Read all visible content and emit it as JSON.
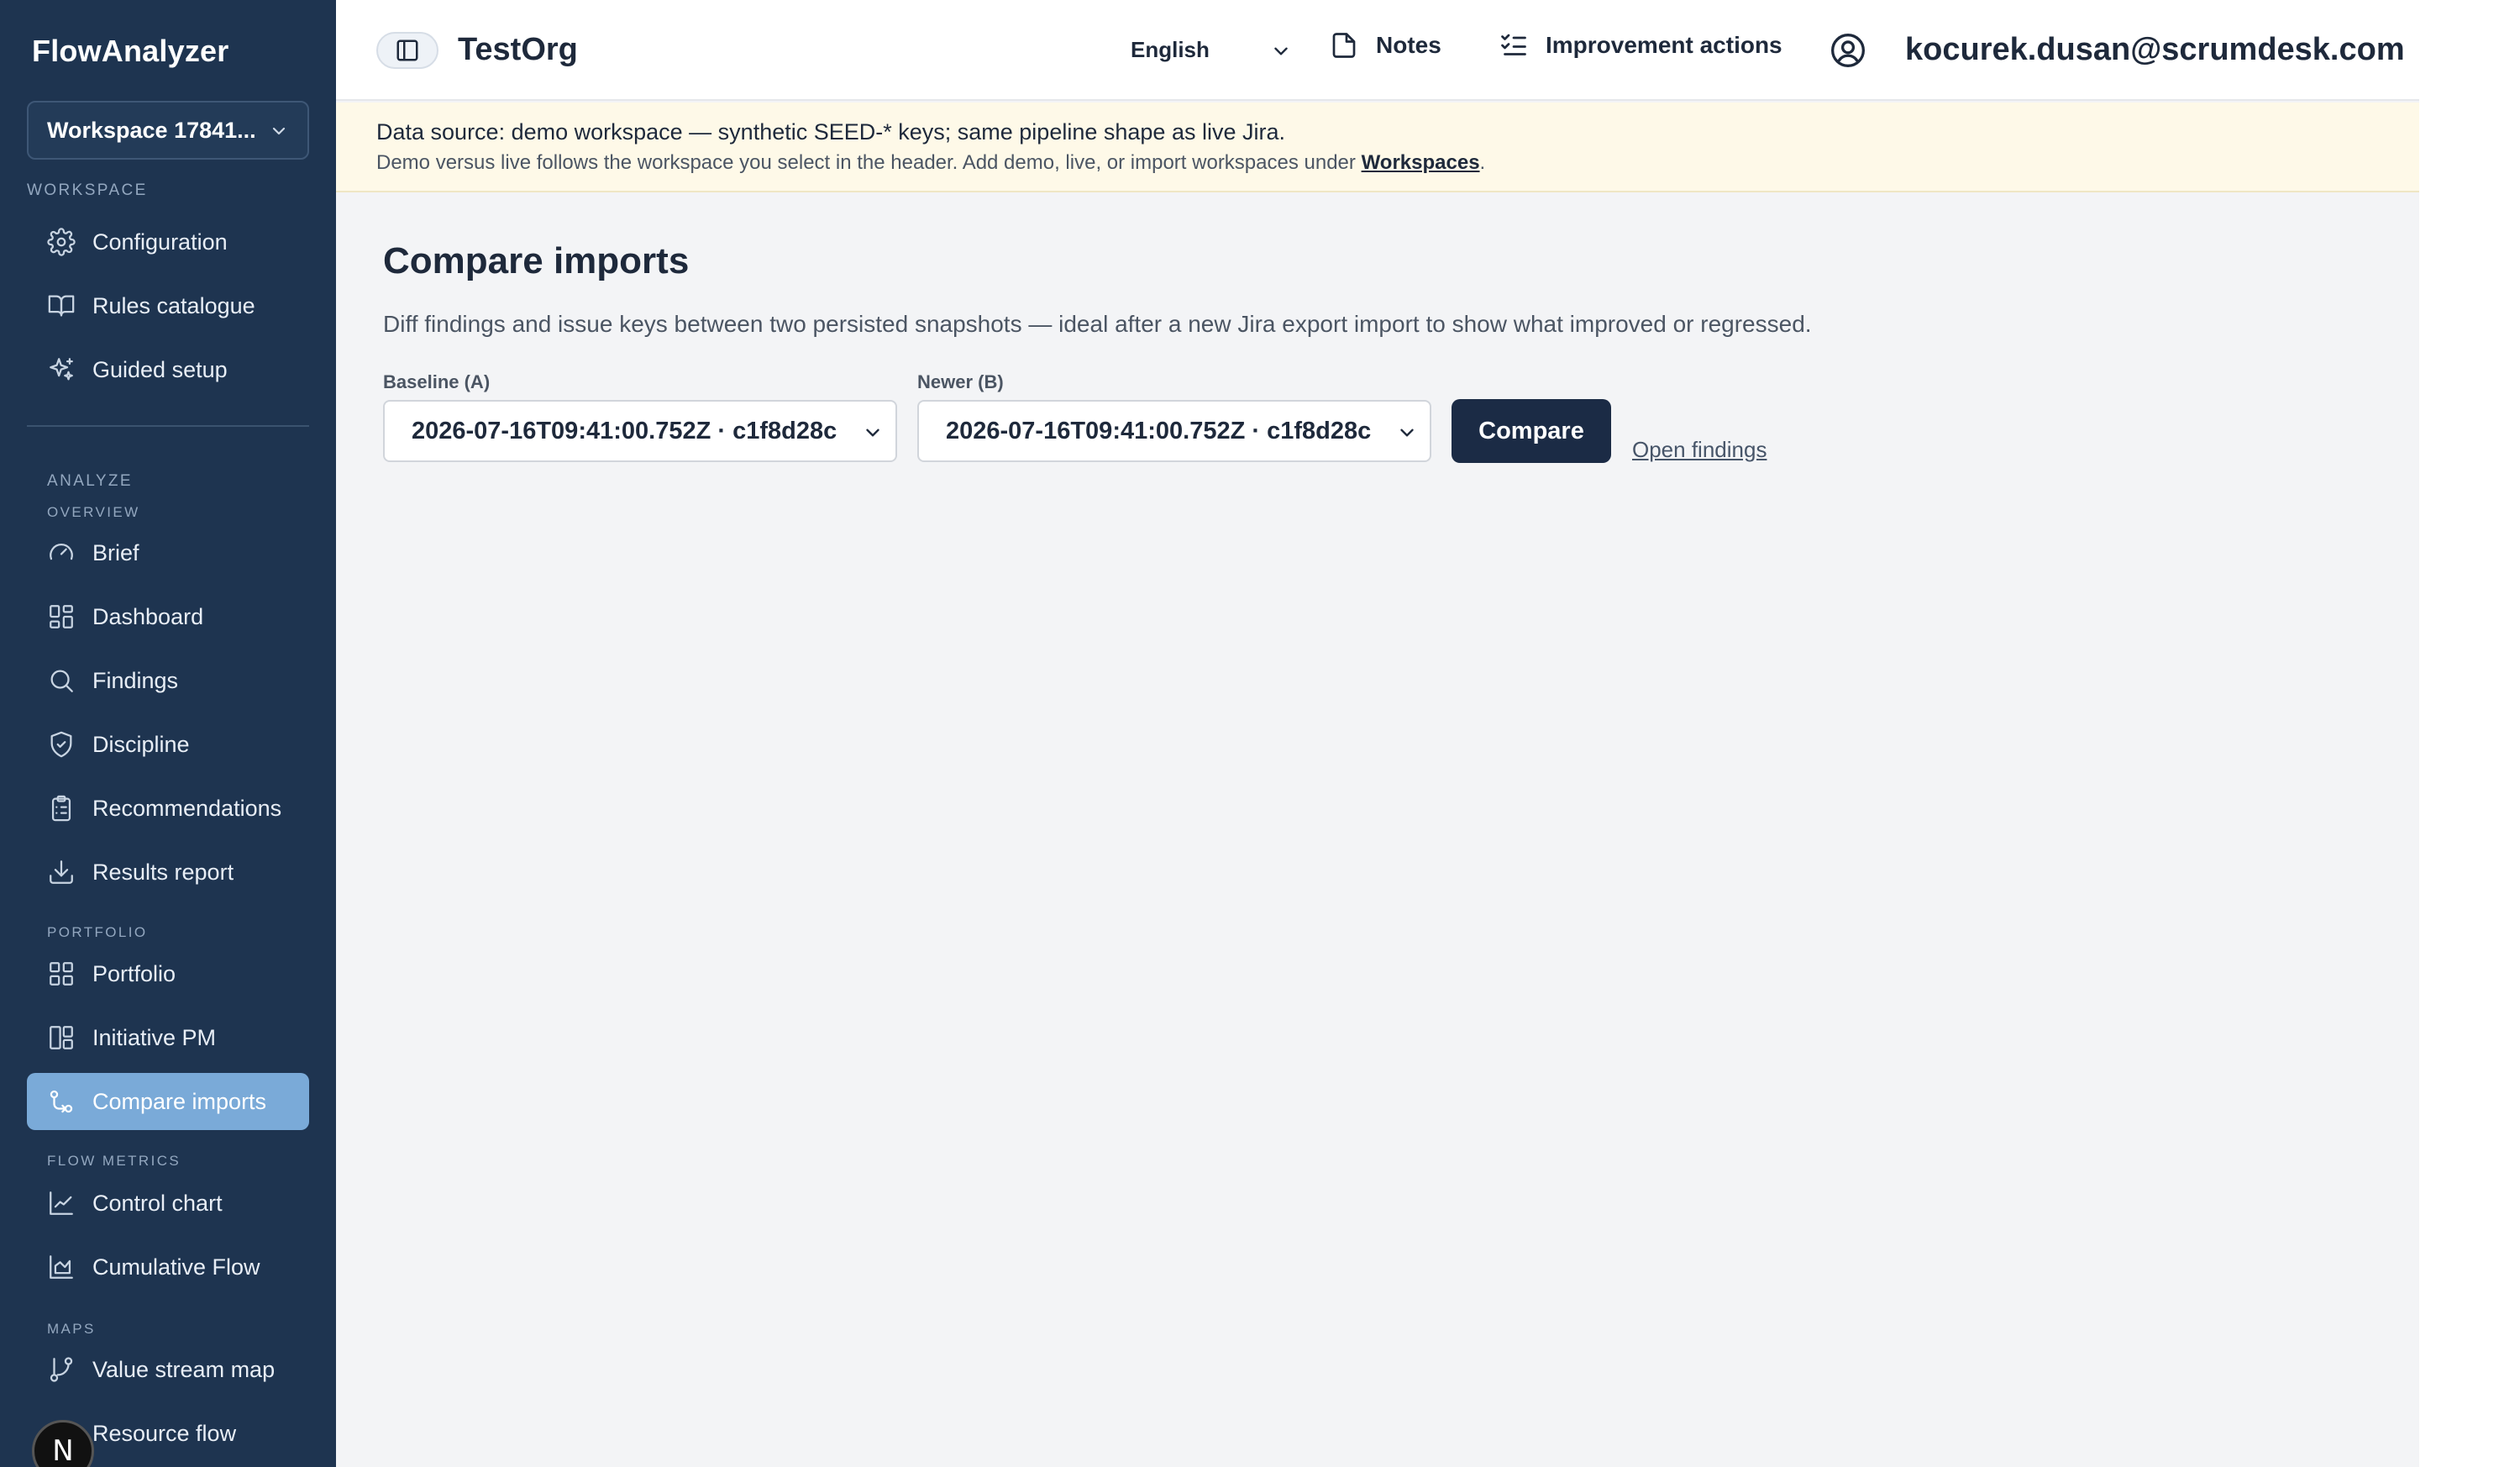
{
  "app": {
    "brand": "FlowAnalyzer"
  },
  "workspace": {
    "selected": "Workspace 17841..."
  },
  "sidebar": {
    "sections": {
      "workspace": "WORKSPACE",
      "analyze": "ANALYZE",
      "overview": "OVERVIEW",
      "portfolio": "PORTFOLIO",
      "flow_metrics": "FLOW METRICS",
      "maps": "MAPS"
    },
    "items": {
      "configuration": "Configuration",
      "rules_catalogue": "Rules catalogue",
      "guided_setup": "Guided setup",
      "brief": "Brief",
      "dashboard": "Dashboard",
      "findings": "Findings",
      "discipline": "Discipline",
      "recommendations": "Recommendations",
      "results_report": "Results report",
      "portfolio": "Portfolio",
      "initiative_pm": "Initiative PM",
      "compare_imports": "Compare imports",
      "control_chart": "Control chart",
      "cumulative_flow": "Cumulative Flow",
      "value_stream_map": "Value stream map",
      "resource_flow": "Resource flow"
    },
    "active": "compare_imports",
    "badge": "N"
  },
  "header": {
    "org": "TestOrg",
    "language": "English",
    "notes": "Notes",
    "improvement_actions": "Improvement actions",
    "user_email": "kocurek.dusan@scrumdesk.com"
  },
  "banner": {
    "line1": "Data source: demo workspace — synthetic SEED-* keys; same pipeline shape as live Jira.",
    "line2_prefix": "Demo versus live follows the workspace you select in the header. Add demo, live, or import workspaces under ",
    "line2_link": "Workspaces",
    "line2_suffix": "."
  },
  "main": {
    "title": "Compare imports",
    "description": "Diff findings and issue keys between two persisted snapshots — ideal after a new Jira export import to show what improved or regressed.",
    "baseline_label": "Baseline (A)",
    "baseline_value": "2026-07-16T09:41:00.752Z · c1f8d28c",
    "newer_label": "Newer (B)",
    "newer_value": "2026-07-16T09:41:00.752Z · c1f8d28c",
    "compare_button": "Compare",
    "open_findings_link": "Open findings"
  },
  "colors": {
    "sidebar_bg": "#1e3450",
    "active_item": "#7aaad8",
    "banner_bg": "#fef9e8",
    "primary_button": "#1b2b45"
  }
}
